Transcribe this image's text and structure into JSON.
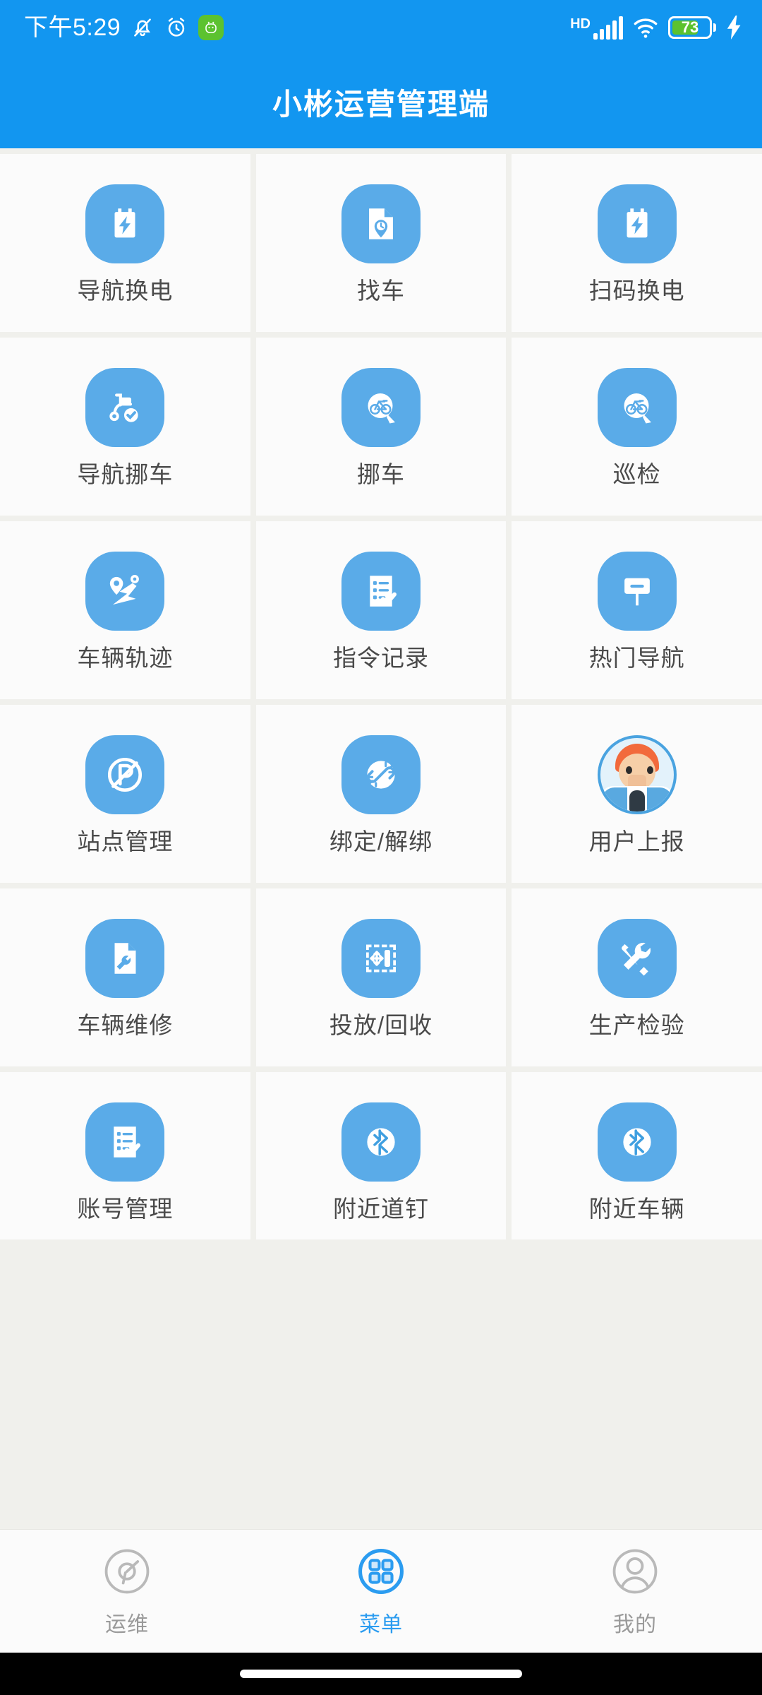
{
  "statusbar": {
    "time": "下午5:29",
    "icons_left": [
      "bell-muted-icon",
      "alarm-clock-icon",
      "green-app-icon"
    ],
    "network_label": "HD",
    "icons_right": [
      "signal-bars-icon",
      "wifi-icon",
      "battery-icon",
      "charging-bolt-icon"
    ],
    "battery_percent": "73",
    "battery_color": "#5cc22f",
    "bar_color": "#1296f0"
  },
  "header": {
    "title": "小彬运营管理端",
    "background": "#1296f0",
    "text_color": "#ffffff"
  },
  "theme": {
    "icon_blue": "#5aabe8",
    "accent_blue": "#2b9cf0",
    "page_background": "#f0f0ec",
    "card_background": "#fbfbfb",
    "label_color": "#4a4a4a",
    "inactive_nav_color": "#9a9a9a"
  },
  "grid": {
    "columns": 3,
    "items": [
      {
        "label": "导航换电",
        "icon": "battery-bolt-icon"
      },
      {
        "label": "找车",
        "icon": "document-location-clock-icon"
      },
      {
        "label": "扫码换电",
        "icon": "battery-bolt-icon"
      },
      {
        "label": "导航挪车",
        "icon": "scooter-check-icon"
      },
      {
        "label": "挪车",
        "icon": "bike-search-icon"
      },
      {
        "label": "巡检",
        "icon": "bike-search-icon"
      },
      {
        "label": "车辆轨迹",
        "icon": "route-track-icon"
      },
      {
        "label": "指令记录",
        "icon": "checklist-icon"
      },
      {
        "label": "热门导航",
        "icon": "signpost-icon"
      },
      {
        "label": "站点管理",
        "icon": "no-parking-icon"
      },
      {
        "label": "绑定/解绑",
        "icon": "broken-link-icon"
      },
      {
        "label": "用户上报",
        "icon": "reporter-avatar-icon"
      },
      {
        "label": "车辆维修",
        "icon": "document-wrench-icon"
      },
      {
        "label": "投放/回收",
        "icon": "move-arrows-icon"
      },
      {
        "label": "生产检验",
        "icon": "wrench-screwdriver-icon"
      },
      {
        "label": "账号管理",
        "icon": "checklist-icon"
      },
      {
        "label": "附近道钉",
        "icon": "bluetooth-icon"
      },
      {
        "label": "附近车辆",
        "icon": "bluetooth-icon"
      }
    ]
  },
  "bottom_nav": {
    "items": [
      {
        "label": "运维",
        "icon": "gauge-icon",
        "active": false
      },
      {
        "label": "菜单",
        "icon": "grid-menu-icon",
        "active": true
      },
      {
        "label": "我的",
        "icon": "person-icon",
        "active": false
      }
    ]
  }
}
